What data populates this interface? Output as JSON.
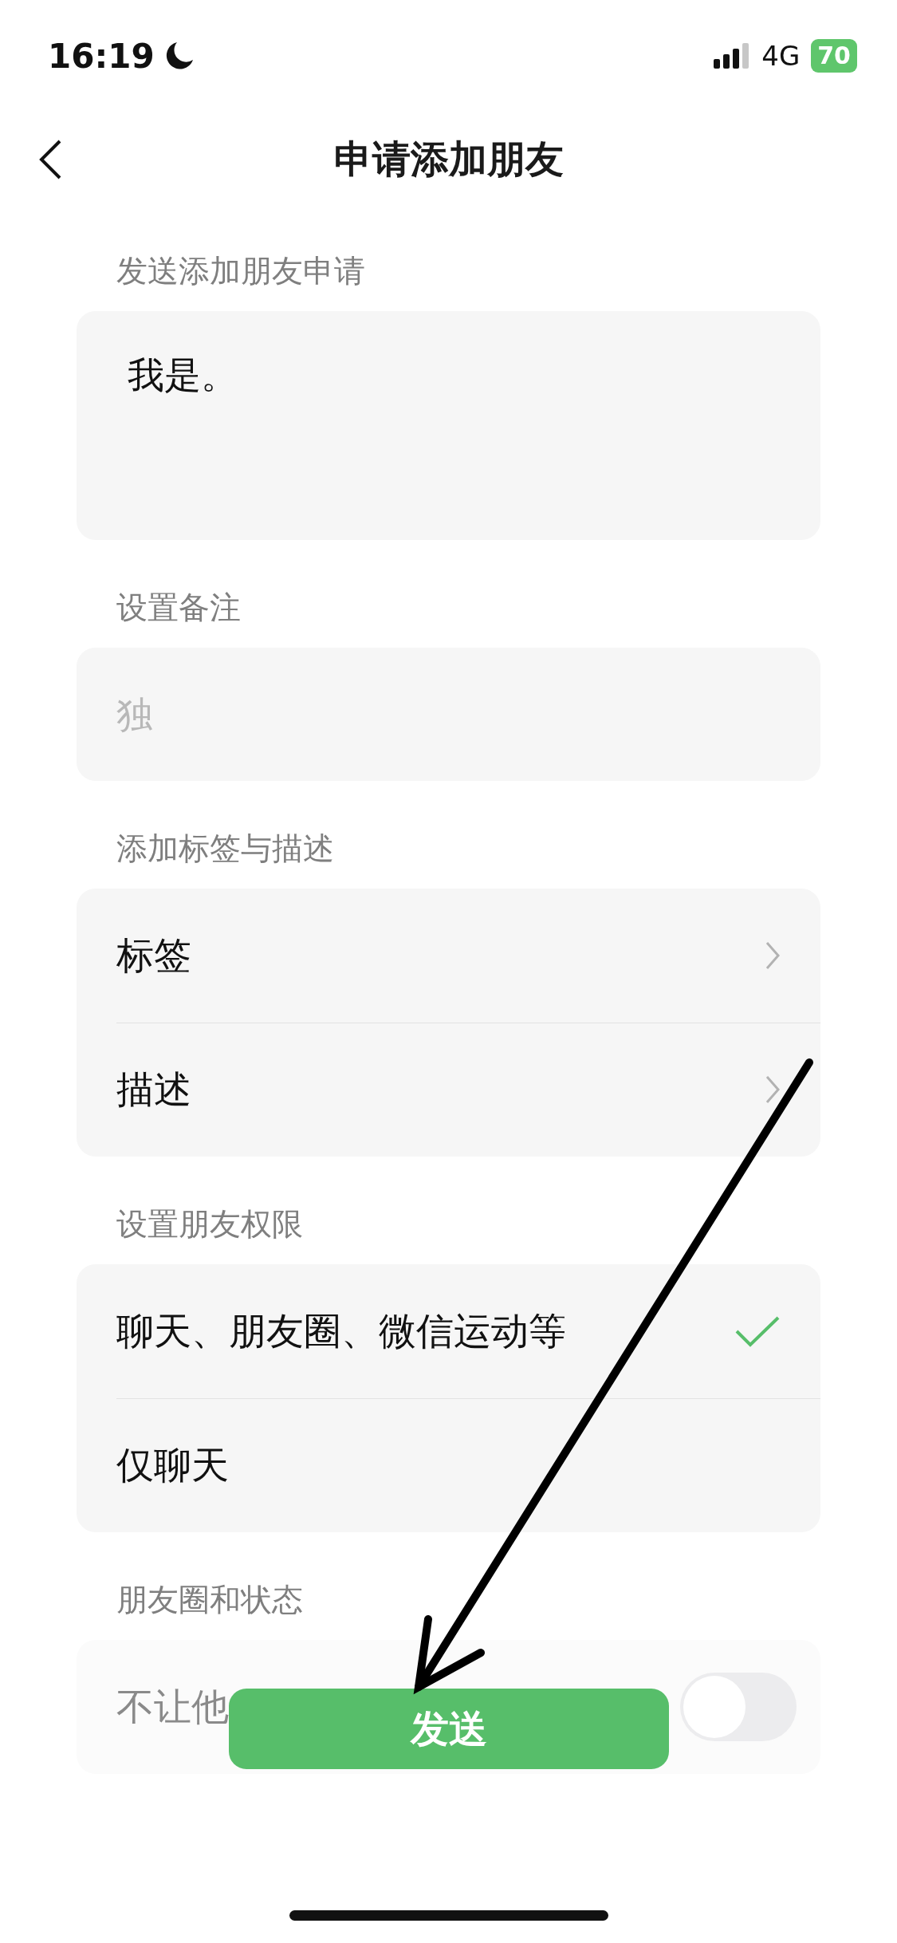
{
  "status_bar": {
    "time": "16:19",
    "network": "4G",
    "battery": "70"
  },
  "nav": {
    "title": "申请添加朋友"
  },
  "sections": [
    {
      "label": "发送添加朋友申请",
      "kind": "textarea",
      "value": "我是。"
    },
    {
      "label": "设置备注",
      "kind": "input",
      "placeholder": "独"
    },
    {
      "label": "添加标签与描述",
      "kind": "links",
      "rows": [
        {
          "label": "标签"
        },
        {
          "label": "描述"
        }
      ]
    },
    {
      "label": "设置朋友权限",
      "kind": "options",
      "rows": [
        {
          "label": "聊天、朋友圈、微信运动等",
          "selected": true
        },
        {
          "label": "仅聊天",
          "selected": false
        }
      ]
    },
    {
      "label": "朋友圈和状态",
      "kind": "toggles",
      "rows": [
        {
          "label": "不让他",
          "on": false
        }
      ]
    }
  ],
  "send_button": {
    "label": "发送"
  }
}
